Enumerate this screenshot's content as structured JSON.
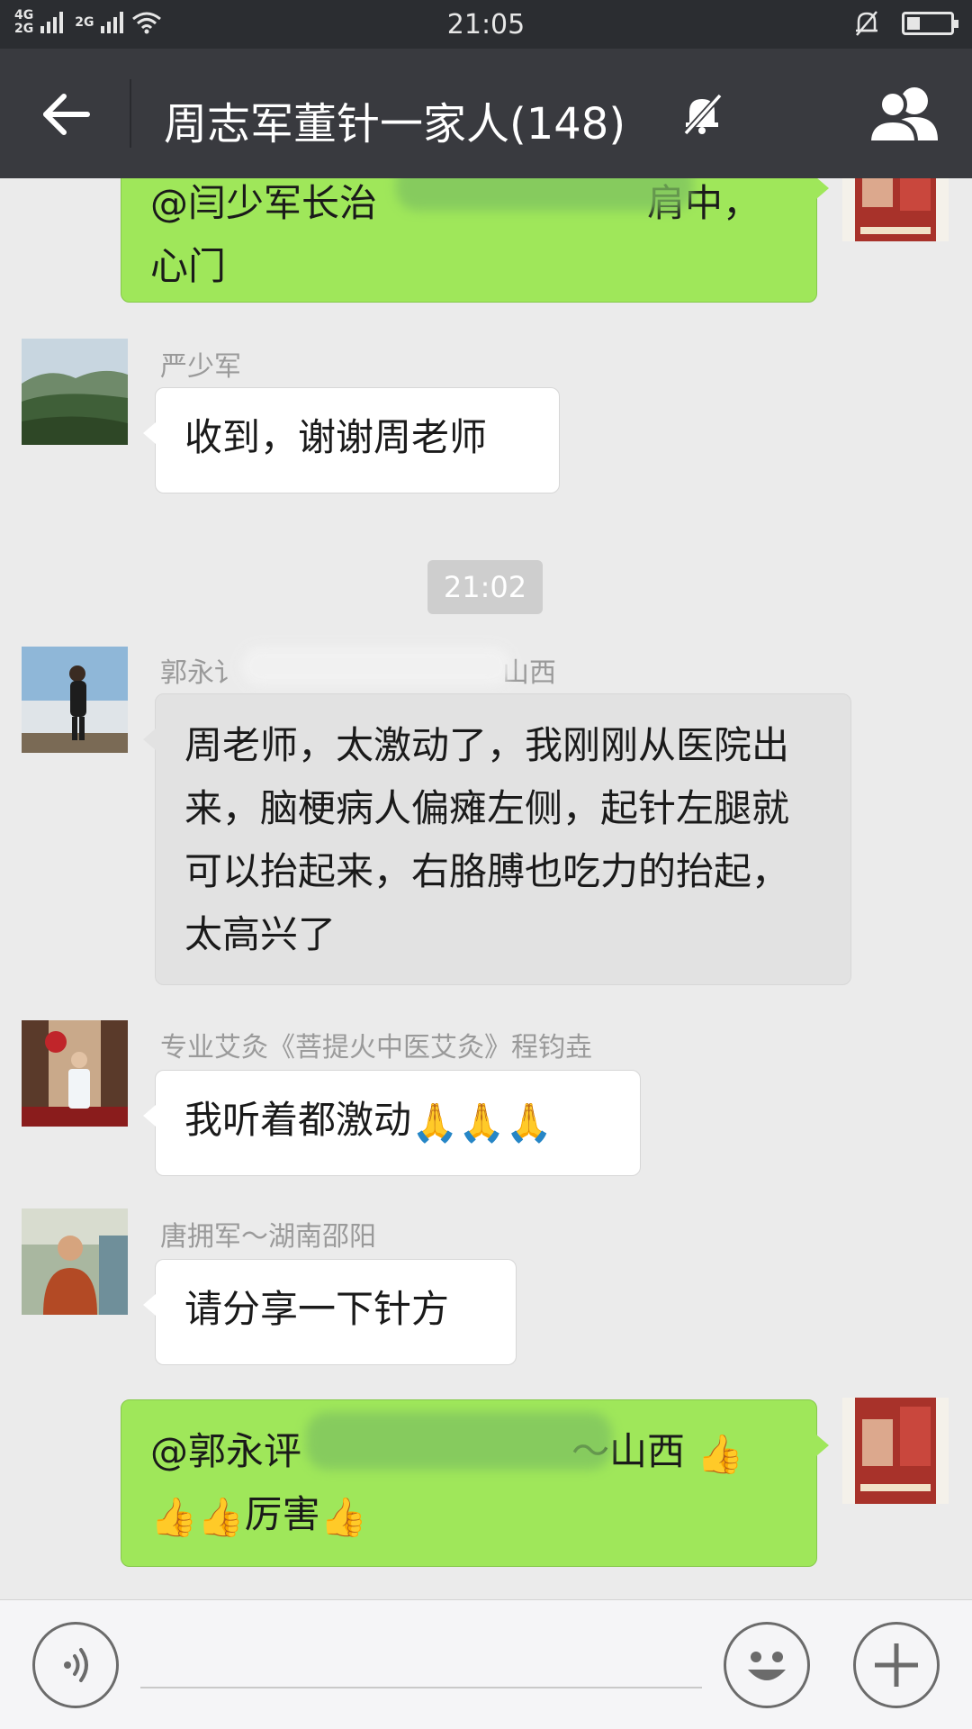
{
  "status_bar": {
    "network_top": "4G",
    "network_bottom": "2G",
    "network_alt": "2G",
    "time": "21:05"
  },
  "title_bar": {
    "title": "周志军董针一家人(148)",
    "icons": {
      "back": "arrow-left-icon",
      "mute": "bell-off-icon",
      "members": "group-members-icon"
    }
  },
  "messages": [
    {
      "direction": "out",
      "text_line1": "@闫少军长治",
      "text_line1_tail": "肩中，",
      "text_line2": "心门"
    },
    {
      "direction": "in",
      "sender": "严少军",
      "text": "收到，谢谢周老师"
    },
    {
      "timestamp": "21:02"
    },
    {
      "direction": "in",
      "sender": "郭永讠",
      "sender_tail": "山西",
      "text": "周老师，太激动了，我刚刚从医院出来，脑梗病人偏瘫左侧，起针左腿就可以抬起来，右胳膊也吃力的抬起，太高兴了"
    },
    {
      "direction": "in",
      "sender": "专业艾灸《菩提火中医艾灸》程钧垚",
      "text": "我听着都激动",
      "emojis": [
        "🙏",
        "🙏",
        "🙏"
      ]
    },
    {
      "direction": "in",
      "sender": "唐拥军～湖南邵阳",
      "text": "请分享一下针方"
    },
    {
      "direction": "out",
      "text_line1": "@郭永评",
      "text_line1_tail": "～山西",
      "text_line2": "厉害",
      "emojis_a": [
        "👍"
      ],
      "emojis_b": [
        "👍",
        "👍"
      ],
      "emojis_c": [
        "👍"
      ]
    }
  ],
  "input_bar": {
    "icons": {
      "voice": "voice-icon",
      "emoji": "emoji-icon",
      "more": "plus-icon"
    }
  }
}
